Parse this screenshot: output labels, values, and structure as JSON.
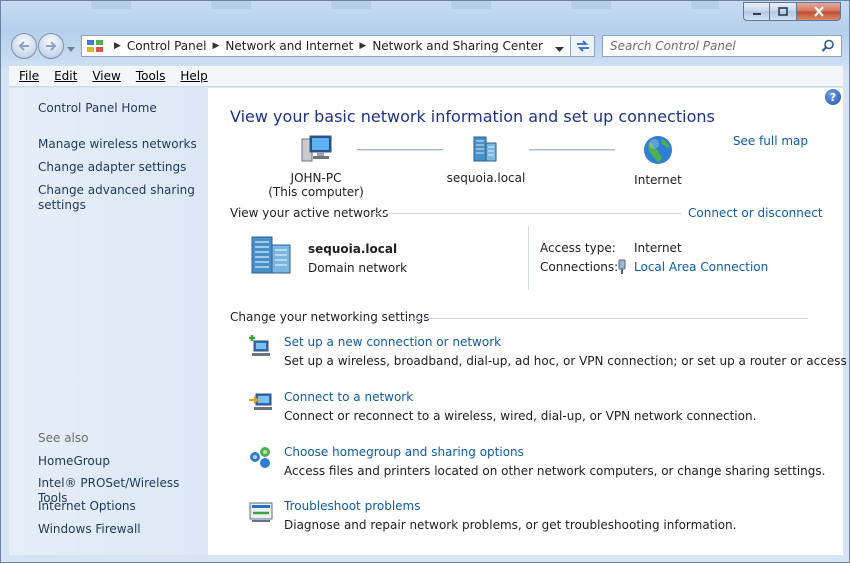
{
  "window": {
    "accent_color": "#1e3287",
    "link_color": "#0f5ba8"
  },
  "navigation": {
    "breadcrumbs": [
      "Control Panel",
      "Network and Internet",
      "Network and Sharing Center"
    ],
    "search_placeholder": "Search Control Panel"
  },
  "menu": {
    "items": [
      "File",
      "Edit",
      "View",
      "Tools",
      "Help"
    ]
  },
  "sidebar": {
    "home": "Control Panel Home",
    "tasks": [
      "Manage wireless networks",
      "Change adapter settings",
      "Change advanced sharing settings"
    ],
    "see_also_label": "See also",
    "see_also": [
      "HomeGroup",
      "Intel® PROSet/Wireless Tools",
      "Internet Options",
      "Windows Firewall"
    ]
  },
  "main": {
    "title": "View your basic network information and set up connections",
    "see_full_map": "See full map",
    "map": {
      "computer_name": "JOHN-PC",
      "computer_sub": "(This computer)",
      "network": "sequoia.local",
      "internet": "Internet"
    },
    "active_networks": {
      "heading": "View your active networks",
      "connect_link": "Connect or disconnect",
      "network_name": "sequoia.local",
      "network_type": "Domain network",
      "access_type_label": "Access type:",
      "access_type_value": "Internet",
      "connections_label": "Connections:",
      "connections_value": "Local Area Connection"
    },
    "settings": {
      "heading": "Change your networking settings",
      "tasks": [
        {
          "icon": "new-connection-icon",
          "title": "Set up a new connection or network",
          "desc": "Set up a wireless, broadband, dial-up, ad hoc, or VPN connection; or set up a router or access point."
        },
        {
          "icon": "connect-network-icon",
          "title": "Connect to a network",
          "desc": "Connect or reconnect to a wireless, wired, dial-up, or VPN network connection."
        },
        {
          "icon": "homegroup-icon",
          "title": "Choose homegroup and sharing options",
          "desc": "Access files and printers located on other network computers, or change sharing settings."
        },
        {
          "icon": "troubleshoot-icon",
          "title": "Troubleshoot problems",
          "desc": "Diagnose and repair network problems, or get troubleshooting information."
        }
      ]
    }
  }
}
